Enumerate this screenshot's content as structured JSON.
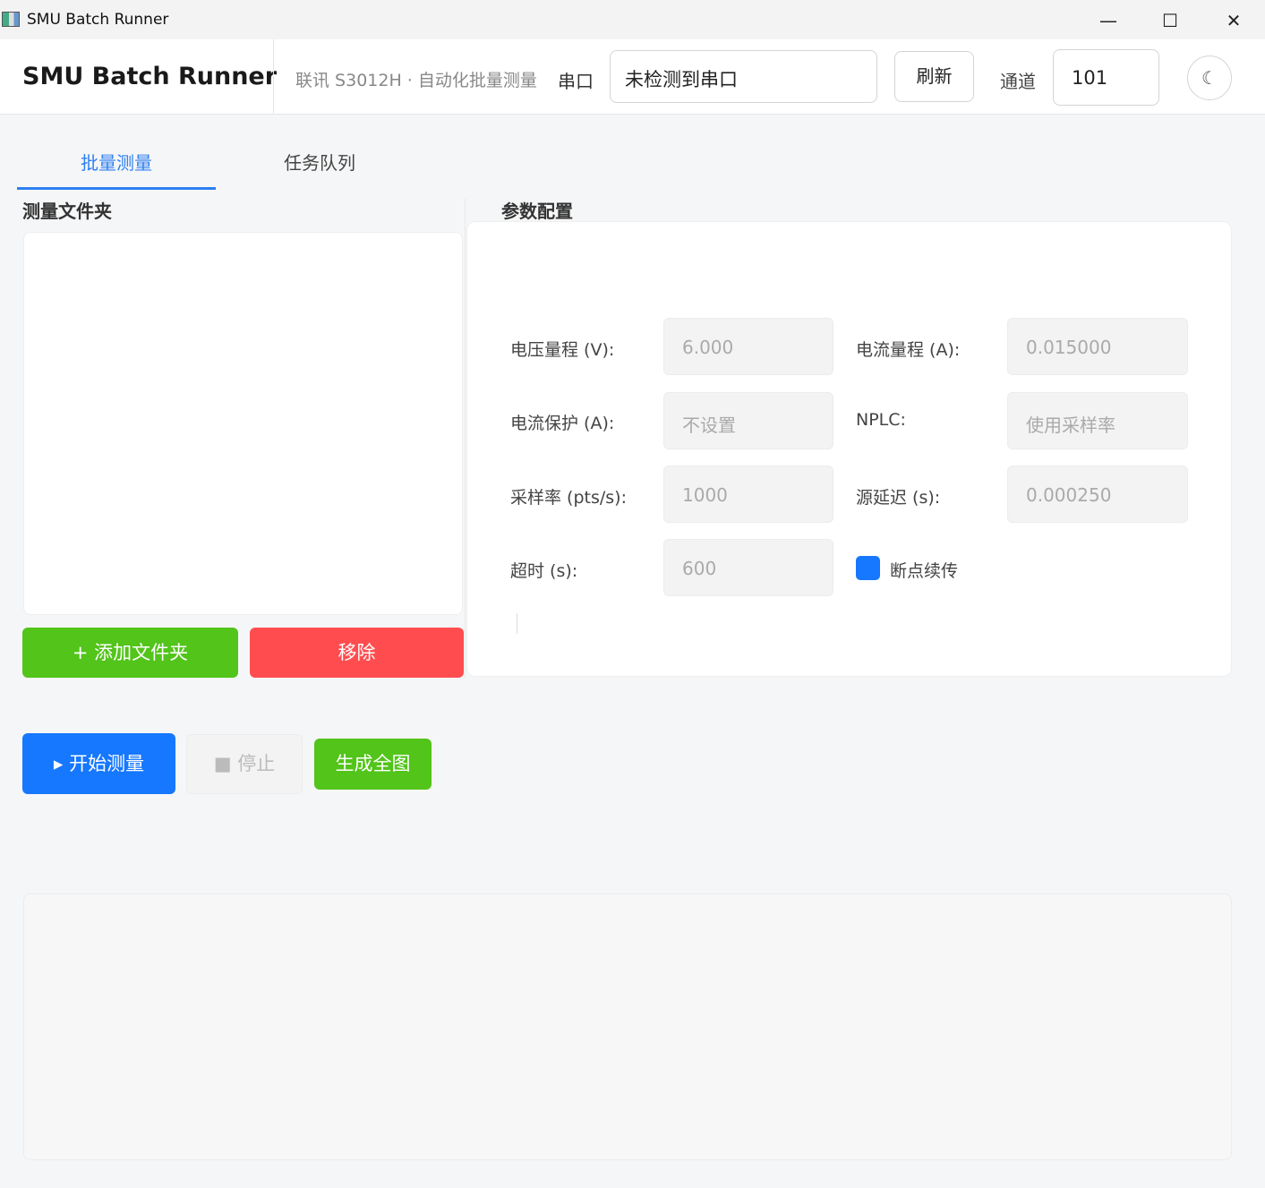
{
  "window": {
    "title": "SMU Batch Runner",
    "minimize_glyph": "—",
    "maximize_glyph": "☐",
    "close_glyph": "✕"
  },
  "header": {
    "brand": "SMU Batch Runner",
    "subtitle": "联讯 S3012H · 自动化批量测量",
    "port_label": "串口",
    "port_value": "未检测到串口",
    "refresh_label": "刷新",
    "channel_label": "通道",
    "channel_value": "101",
    "theme_icon": "☾"
  },
  "tabs": [
    {
      "label": "批量测量",
      "active": true
    },
    {
      "label": "任务队列",
      "active": false
    }
  ],
  "folders": {
    "title": "测量文件夹",
    "items": [],
    "add_label": "+ 添加文件夹",
    "remove_label": "移除"
  },
  "params": {
    "title": "参数配置",
    "voltage_range": {
      "label": "电压量程 (V):",
      "value": "6.000"
    },
    "current_range": {
      "label": "电流量程 (A):",
      "value": "0.015000"
    },
    "current_protect": {
      "label": "电流保护 (A):",
      "placeholder": "不设置"
    },
    "nplc": {
      "label": "NPLC:",
      "placeholder": "使用采样率"
    },
    "sample_rate": {
      "label": "采样率 (pts/s):",
      "value": "1000"
    },
    "source_delay": {
      "label": "源延迟 (s):",
      "value": "0.000250"
    },
    "timeout": {
      "label": "超时 (s):",
      "value": "600"
    },
    "resume": {
      "label": "断点续传",
      "checked": true
    }
  },
  "actions": {
    "start_label": "▸ 开始测量",
    "stop_label": "■ 停止",
    "plot_label": "生成全图"
  },
  "colors": {
    "accent": "#1677ff",
    "success": "#52c41a",
    "danger": "#ff4d4f"
  }
}
